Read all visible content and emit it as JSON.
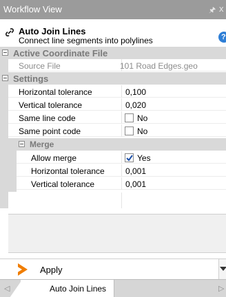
{
  "window": {
    "title": "Workflow View",
    "pin_glyph": "F",
    "close_glyph": "x"
  },
  "command": {
    "name": "Auto Join Lines",
    "description": "Connect line segments into polylines",
    "help_glyph": "?"
  },
  "categories": {
    "active_file": "Active Coordinate File",
    "settings": "Settings",
    "merge": "Merge"
  },
  "properties": {
    "source_file": {
      "label": "Source File",
      "value": "101 Road Edges.geo"
    },
    "horizontal_tolerance": {
      "label": "Horizontal tolerance",
      "value": "0,100"
    },
    "vertical_tolerance": {
      "label": "Vertical tolerance",
      "value": "0,020"
    },
    "same_line_code": {
      "label": "Same line code",
      "value": "No",
      "checked": false
    },
    "same_point_code": {
      "label": "Same point code",
      "value": "No",
      "checked": false
    },
    "allow_merge": {
      "label": "Allow merge",
      "value": "Yes",
      "checked": true
    },
    "merge_horizontal_tolerance": {
      "label": "Horizontal tolerance",
      "value": "0,001"
    },
    "merge_vertical_tolerance": {
      "label": "Vertical tolerance",
      "value": "0,001"
    }
  },
  "apply": {
    "label": "Apply"
  },
  "tabs": [
    {
      "label": "Auto Join Lines",
      "active": true
    }
  ],
  "nav": {
    "prev": "◁",
    "next": "▷"
  },
  "colors": {
    "accent_orange": "#f07d00",
    "titlebar": "#9b9b9b",
    "help_blue": "#2f7fd6"
  }
}
